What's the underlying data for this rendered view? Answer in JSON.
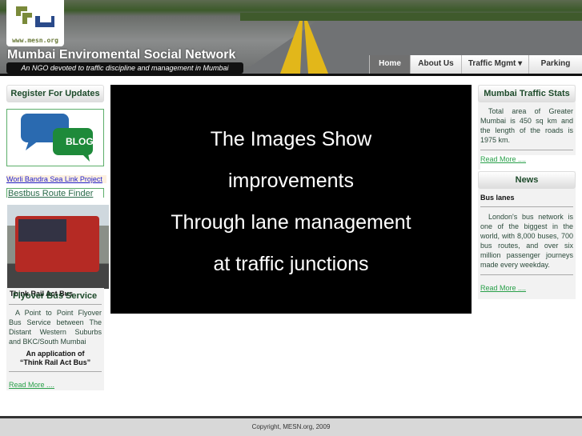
{
  "header": {
    "logo_text": "www.mesn.org",
    "site_title": "Mumbai Enviromental Social Network",
    "tagline": "An NGO devoted to traffic discipline and management in Mumbai"
  },
  "nav": {
    "items": [
      {
        "label": "Home"
      },
      {
        "label": "About Us"
      },
      {
        "label": "Traffic Mgmt ▾"
      },
      {
        "label": "Parking"
      }
    ]
  },
  "left": {
    "register_title": "Register For Updates",
    "blog_label": "BLOG",
    "sealink": "Worli Bandra Sea Link Project",
    "bestbus": "Bestbus Route Finder",
    "bus_caption": "Think Rail Act Bus",
    "flyover_title": "Flyover Bus Service",
    "flyover_text": "A Point to Point Flyover Bus Service between The Distant Western Suburbs and BKC/South Mumbai",
    "app_line1": "An application of",
    "app_line2": "“Think Rail Act Bus”",
    "read_more": "Read More ...."
  },
  "slide": {
    "lines": [
      "The Images Show",
      "improvements",
      "Through lane management",
      "at traffic junctions"
    ]
  },
  "right": {
    "stats_title": "Mumbai Traffic Stats",
    "stats_text": "Total area of Greater Mumbai is 450 sq km and the length of the roads is 1975 km.",
    "stats_more": "Read More ....",
    "news_title": "News",
    "news_heading": "Bus lanes",
    "news_text": "London's bus network is one of the biggest in the world, with 8,000 buses, 700 bus routes, and over six million passenger journeys made every weekday.",
    "news_more": "Read More ...."
  },
  "footer": {
    "copyright": "Copyright, MESN.org, 2009"
  }
}
